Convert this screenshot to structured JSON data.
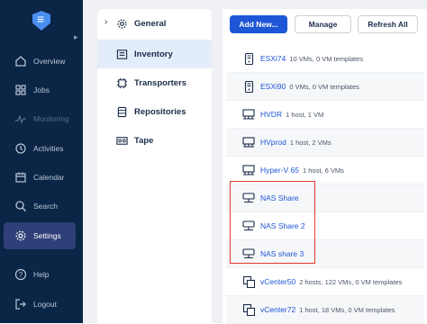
{
  "nav": {
    "items": [
      {
        "label": "Overview",
        "icon": "home-icon"
      },
      {
        "label": "Jobs",
        "icon": "grid-icon"
      },
      {
        "label": "Monitoring",
        "icon": "activity-icon"
      },
      {
        "label": "Activities",
        "icon": "clock-icon"
      },
      {
        "label": "Calendar",
        "icon": "calendar-icon"
      },
      {
        "label": "Search",
        "icon": "search-icon"
      },
      {
        "label": "Settings",
        "icon": "gear-icon"
      },
      {
        "label": "Help",
        "icon": "help-icon"
      },
      {
        "label": "Logout",
        "icon": "logout-icon"
      }
    ],
    "active": "Settings",
    "disabled": "Monitoring"
  },
  "settings_menu": {
    "items": [
      {
        "label": "General",
        "icon": "gear-icon"
      },
      {
        "label": "Inventory",
        "icon": "inventory-icon"
      },
      {
        "label": "Transporters",
        "icon": "chip-icon"
      },
      {
        "label": "Repositories",
        "icon": "database-icon"
      },
      {
        "label": "Tape",
        "icon": "tape-icon"
      }
    ],
    "active": "Inventory"
  },
  "toolbar": {
    "add_label": "Add New...",
    "manage_label": "Manage",
    "refresh_label": "Refresh All"
  },
  "inventory": [
    {
      "name": "ESXi74",
      "desc": "10 VMs, 0 VM templates",
      "icon": "server-icon"
    },
    {
      "name": "ESXi90",
      "desc": "0 VMs, 0 VM templates",
      "icon": "server-icon"
    },
    {
      "name": "HVDR",
      "desc": "1 host, 1 VM",
      "icon": "cluster-icon"
    },
    {
      "name": "HVprod",
      "desc": "1 host, 2 VMs",
      "icon": "cluster-icon"
    },
    {
      "name": "Hyper-V 65",
      "desc": "1 host, 6 VMs",
      "icon": "cluster-icon"
    },
    {
      "name": "NAS Share",
      "desc": "",
      "icon": "nas-icon"
    },
    {
      "name": "NAS Share 2",
      "desc": "",
      "icon": "nas-icon"
    },
    {
      "name": "NAS share 3",
      "desc": "",
      "icon": "nas-icon"
    },
    {
      "name": "vCenter50",
      "desc": "2 hosts, 122 VMs, 0 VM templates",
      "icon": "vcenter-icon"
    },
    {
      "name": "vCenter72",
      "desc": "1 host, 18 VMs, 0 VM templates",
      "icon": "vcenter-icon"
    }
  ],
  "colors": {
    "accent": "#1d56d6",
    "nav_bg": "#0a2546",
    "nav_active": "#2f3f78",
    "highlight": "#e23a2f"
  }
}
